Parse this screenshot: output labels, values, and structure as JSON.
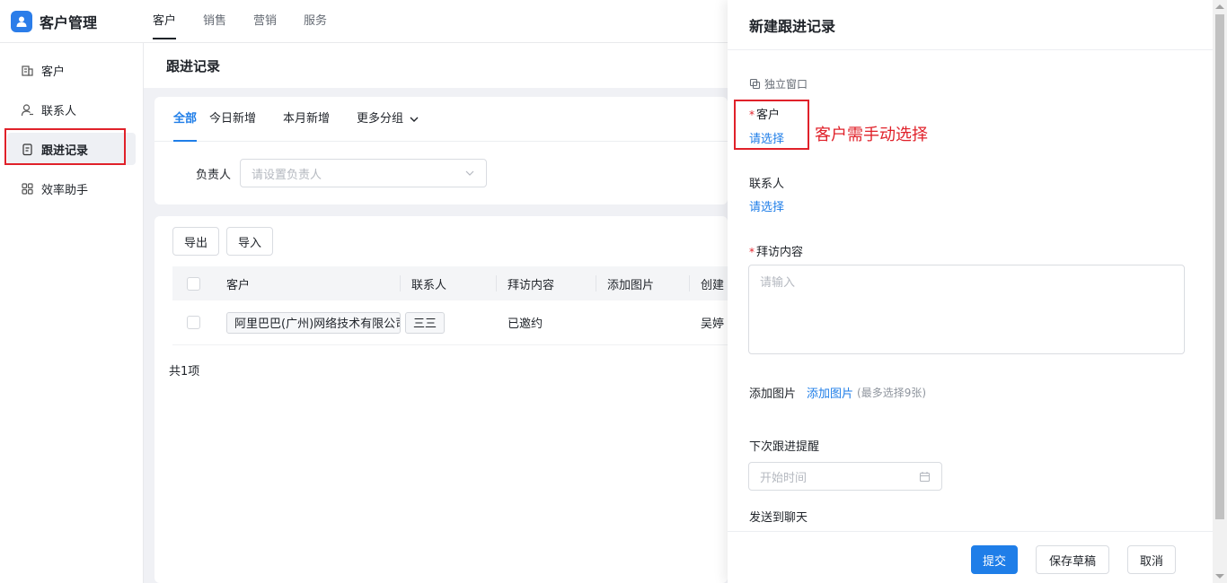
{
  "app": {
    "title": "客户管理",
    "brand_color": "#2b7de9"
  },
  "topnav": [
    {
      "label": "客户",
      "active": true
    },
    {
      "label": "销售"
    },
    {
      "label": "营销"
    },
    {
      "label": "服务"
    }
  ],
  "sidebar": {
    "items": [
      {
        "label": "客户",
        "icon": "building-icon"
      },
      {
        "label": "联系人",
        "icon": "contact-icon"
      },
      {
        "label": "跟进记录",
        "icon": "clipboard-icon",
        "active": true
      },
      {
        "label": "效率助手",
        "icon": "grid-icon"
      }
    ]
  },
  "main": {
    "page_title": "跟进记录",
    "tabs": [
      {
        "label": "全部",
        "active": true
      },
      {
        "label": "今日新增"
      },
      {
        "label": "本月新增"
      },
      {
        "label": "更多分组"
      }
    ],
    "filter": {
      "label": "负责人",
      "placeholder": "请设置负责人"
    },
    "buttons": {
      "export": "导出",
      "import": "导入"
    },
    "table": {
      "columns": [
        "客户",
        "联系人",
        "拜访内容",
        "添加图片",
        "创建"
      ],
      "rows": [
        {
          "customer": "阿里巴巴(广州)网络技术有限公司",
          "contact": "三三",
          "visit_content": "已邀约",
          "image": "",
          "creator": "吴婷"
        }
      ],
      "total": "共1项"
    }
  },
  "drawer": {
    "title": "新建跟进记录",
    "popout_label": "独立窗口",
    "customer": {
      "label": "客户",
      "required": true,
      "action": "请选择"
    },
    "annotation": "客户需手动选择",
    "contact": {
      "label": "联系人",
      "action": "请选择"
    },
    "visit_content": {
      "label": "拜访内容",
      "required": true,
      "placeholder": "请输入"
    },
    "images": {
      "label": "添加图片",
      "action": "添加图片",
      "hint": "(最多选择9张)"
    },
    "reminder": {
      "label": "下次跟进提醒",
      "placeholder": "开始时间"
    },
    "send_chat": {
      "label": "发送到聊天"
    },
    "footer": {
      "submit": "提交",
      "save_draft": "保存草稿",
      "cancel": "取消"
    }
  },
  "colors": {
    "accent": "#1f7ee8",
    "highlight_red": "#e0212a"
  }
}
